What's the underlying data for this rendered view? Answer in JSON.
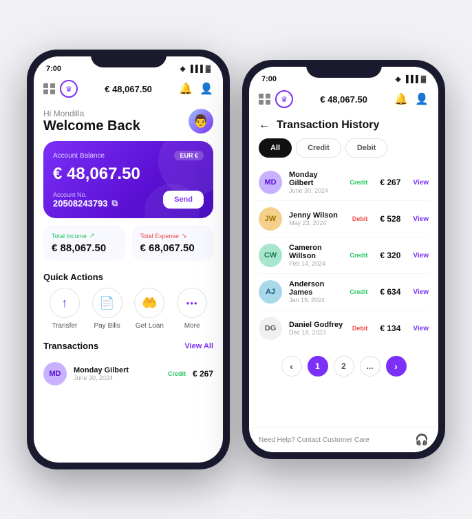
{
  "phone1": {
    "statusBar": {
      "time": "7:00"
    },
    "topBar": {
      "balance": "€ 48,067.50"
    },
    "welcome": {
      "greeting": "Hi Mondilla",
      "title": "Welcome Back"
    },
    "balanceCard": {
      "label": "Account Balance",
      "currency": "EUR €",
      "amount": "€ 48,067.50",
      "accountLabel": "Account No.",
      "accountNumber": "20508243793",
      "sendLabel": "Send"
    },
    "stats": {
      "income": {
        "label": "Total Income",
        "amount": "€ 88,067.50"
      },
      "expense": {
        "label": "Total Expense",
        "amount": "€ 68,067.50"
      }
    },
    "quickActions": {
      "title": "Quick Actions",
      "items": [
        {
          "icon": "↑",
          "label": "Transfer"
        },
        {
          "icon": "📄",
          "label": "Pay Bills"
        },
        {
          "icon": "🤲",
          "label": "Get Loan"
        },
        {
          "icon": "•••",
          "label": "More"
        }
      ]
    },
    "transactions": {
      "title": "Transactions",
      "viewAll": "View All",
      "items": [
        {
          "initials": "MD",
          "name": "Monday Gilbert",
          "date": "June 30, 2024",
          "type": "Credit",
          "amount": "€ 267"
        }
      ]
    }
  },
  "phone2": {
    "statusBar": {
      "time": "7:00"
    },
    "topBar": {
      "balance": "€ 48,067.50"
    },
    "pageTitle": "Transaction History",
    "tabs": [
      "All",
      "Credit",
      "Debit"
    ],
    "activeTab": "All",
    "transactions": [
      {
        "initials": "MD",
        "name": "Monday Gilbert",
        "date": "June 30, 2024",
        "type": "Credit",
        "amount": "€ 267",
        "color": "color-md",
        "textColor": "#9b59f7"
      },
      {
        "initials": "JW",
        "name": "Jenny Wilson",
        "date": "May 23, 2024",
        "type": "Debit",
        "amount": "€ 528",
        "color": "color-jw",
        "textColor": "#f5a623"
      },
      {
        "initials": "CW",
        "name": "Cameron Willson",
        "date": "Feb 14, 2024",
        "type": "Credit",
        "amount": "€ 320",
        "color": "color-cw",
        "textColor": "#27ae60"
      },
      {
        "initials": "AJ",
        "name": "Anderson James",
        "date": "Jan 19, 2024",
        "type": "Credit",
        "amount": "€ 634",
        "color": "color-aj",
        "textColor": "#2980b9"
      },
      {
        "initials": "DG",
        "name": "Daniel Godfrey",
        "date": "Dec 18, 2023",
        "type": "Debit",
        "amount": "€ 134",
        "color": "color-dg",
        "textColor": "#777"
      }
    ],
    "pagination": {
      "prev": "‹",
      "pages": [
        "1",
        "2",
        "..."
      ],
      "next": "›"
    },
    "footer": {
      "text": "Need Help? Contact Customer Care"
    }
  }
}
